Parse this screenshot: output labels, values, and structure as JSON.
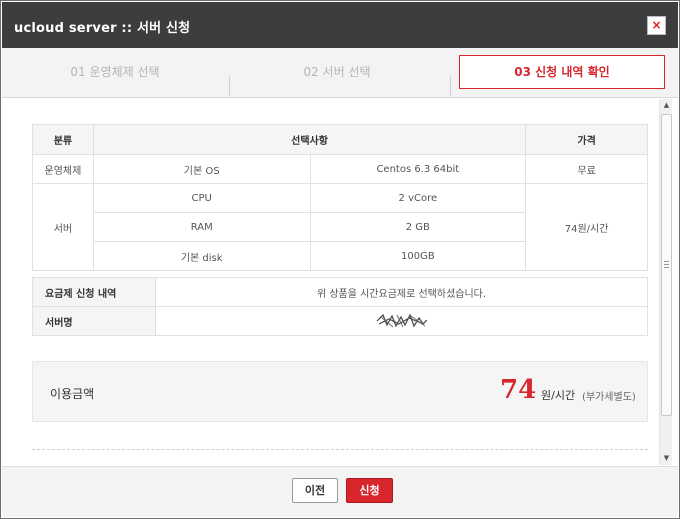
{
  "window": {
    "title": "ucloud server :: 서버 신청",
    "close_label": "×"
  },
  "steps": [
    {
      "label": "01 운영체제 선택",
      "active": false
    },
    {
      "label": "02 서버 선택",
      "active": false
    },
    {
      "label": "03 신청 내역 확인",
      "active": true
    }
  ],
  "spec_table": {
    "headers": {
      "category": "분류",
      "selection": "선택사항",
      "price": "가격"
    },
    "rows": [
      {
        "category": "운영체제",
        "item": "기본 OS",
        "value": "Centos 6.3 64bit",
        "price": "무료"
      },
      {
        "category": "서버",
        "item": "CPU",
        "value": "2 vCore",
        "price": "74원/시간"
      },
      {
        "item": "RAM",
        "value": "2 GB"
      },
      {
        "item": "기본 disk",
        "value": "100GB"
      }
    ]
  },
  "plan_table": {
    "rows": [
      {
        "label": "요금제 신청 내역",
        "value": "위 상품을 시간요금제로 선택하셨습니다."
      },
      {
        "label": "서버명",
        "value": ""
      }
    ]
  },
  "price_summary": {
    "label": "이용금액",
    "amount": "74",
    "unit": "원/시간",
    "note": "(부가세별도)"
  },
  "footer": {
    "prev_label": "이전",
    "apply_label": "신청"
  },
  "colors": {
    "accent": "#d6272f",
    "titlebar": "#3d3d3d"
  },
  "icons": {
    "close": "close-icon",
    "scroll_up": "arrow-up-icon",
    "scroll_down": "arrow-down-icon"
  }
}
